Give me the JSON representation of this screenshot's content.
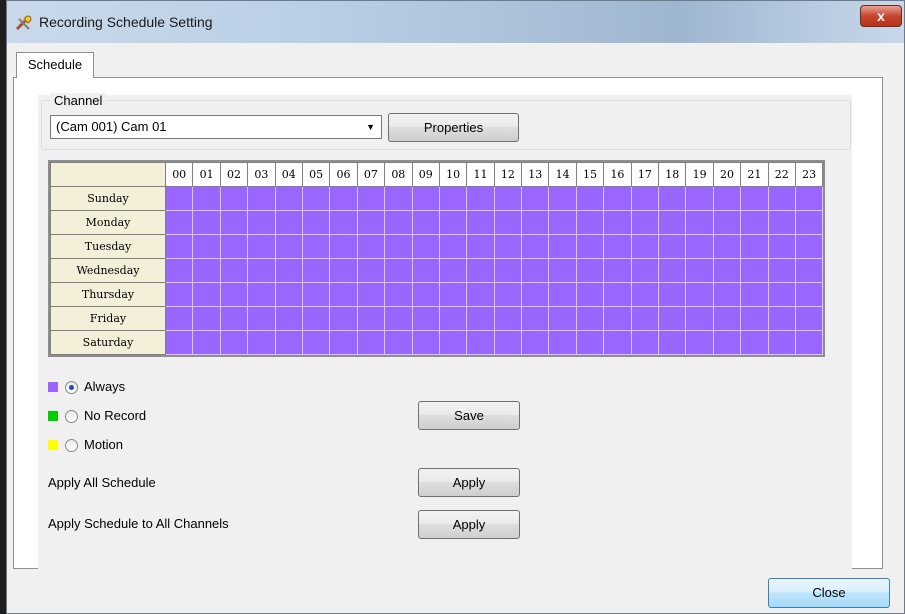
{
  "window": {
    "title": "Recording Schedule Setting",
    "close_glyph": "x"
  },
  "tabs": [
    {
      "label": "Schedule"
    }
  ],
  "channel": {
    "group_label": "Channel",
    "selected": "(Cam 001) Cam 01",
    "properties_label": "Properties"
  },
  "schedule": {
    "hours": [
      "00",
      "01",
      "02",
      "03",
      "04",
      "05",
      "06",
      "07",
      "08",
      "09",
      "10",
      "11",
      "12",
      "13",
      "14",
      "15",
      "16",
      "17",
      "18",
      "19",
      "20",
      "21",
      "22",
      "23"
    ],
    "days": [
      "Sunday",
      "Monday",
      "Tuesday",
      "Wednesday",
      "Thursday",
      "Friday",
      "Saturday"
    ],
    "fill_mode": "Always",
    "fill_color": "#9966ff"
  },
  "legend": [
    {
      "label": "Always",
      "color": "#9966ff",
      "selected": true
    },
    {
      "label": "No Record",
      "color": "#00cc00",
      "selected": false
    },
    {
      "label": "Motion",
      "color": "#ffff00",
      "selected": false
    }
  ],
  "buttons": {
    "save": "Save",
    "apply_all": "Apply",
    "apply_channels": "Apply",
    "close": "Close"
  },
  "labels": {
    "apply_all_schedule": "Apply All Schedule",
    "apply_schedule_all_channels": "Apply Schedule to All Channels"
  },
  "icons": {
    "app": "tools-icon",
    "dropdown": "chevron-down-icon",
    "close": "close-icon"
  }
}
